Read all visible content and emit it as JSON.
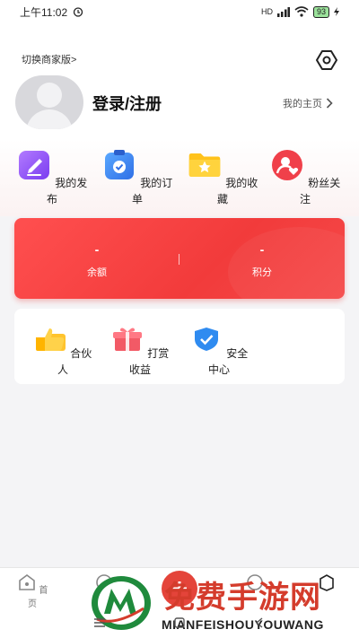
{
  "status_bar": {
    "time": "上午11:02",
    "battery": "93",
    "network": "HD"
  },
  "header": {
    "switch_label": "切换商家版>",
    "login_label": "登录/注册",
    "homepage_label": "我的主页"
  },
  "quick_actions": [
    {
      "label": "我的发布",
      "icon": "edit-icon"
    },
    {
      "label": "我的订单",
      "icon": "clipboard-check-icon"
    },
    {
      "label": "我的收藏",
      "icon": "folder-star-icon"
    },
    {
      "label": "粉丝关注",
      "icon": "user-heart-icon"
    }
  ],
  "wallet": {
    "balance_value": "-",
    "balance_label": "余额",
    "points_value": "-",
    "points_label": "积分"
  },
  "services": [
    {
      "label": "合伙人",
      "icon": "thumbs-up-icon"
    },
    {
      "label": "打赏收益",
      "icon": "gift-icon"
    },
    {
      "label": "安全中心",
      "icon": "shield-check-icon"
    }
  ],
  "tab_bar": {
    "home_label": "首页"
  },
  "watermark": {
    "title": "免费手游网",
    "subtitle": "MIANFEISHOUYOUWANG"
  }
}
